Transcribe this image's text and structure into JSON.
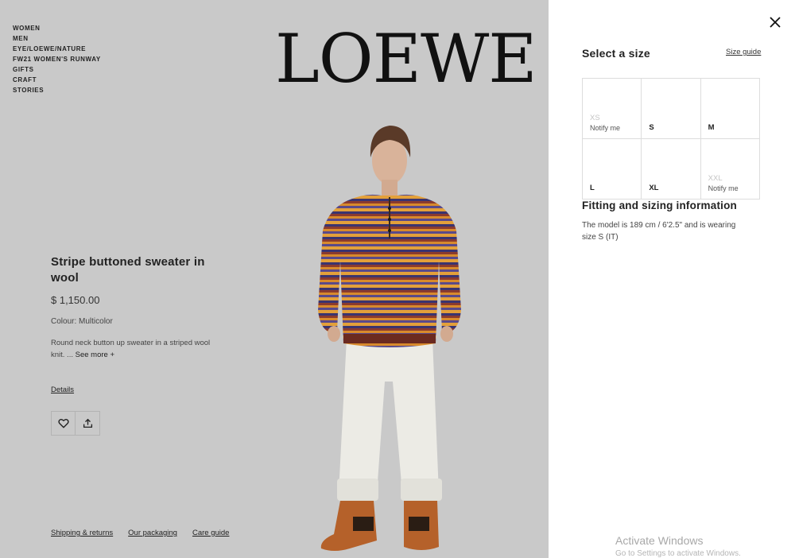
{
  "nav": {
    "items": [
      {
        "label": "WOMEN"
      },
      {
        "label": "MEN"
      },
      {
        "label": "EYE/LOEWE/NATURE"
      },
      {
        "label": "FW21 WOMEN'S RUNWAY"
      },
      {
        "label": "GIFTS"
      },
      {
        "label": "CRAFT"
      },
      {
        "label": "STORIES"
      }
    ]
  },
  "brand": {
    "logo": "LOEWE"
  },
  "product": {
    "title": "Stripe buttoned sweater in wool",
    "price": "$ 1,150.00",
    "colour": "Colour: Multicolor",
    "description": "Round neck button up sweater in a striped wool knit. ...",
    "see_more": "See more +",
    "details_label": "Details",
    "stripe_colors": [
      "#e3a03a",
      "#3a3470",
      "#8b3b2e",
      "#d88a2c",
      "#5a4a8a"
    ]
  },
  "actions": {
    "wishlist_icon": "heart-icon",
    "share_icon": "share-icon"
  },
  "footer": {
    "links": [
      {
        "label": "Shipping & returns"
      },
      {
        "label": "Our packaging"
      },
      {
        "label": "Care guide"
      }
    ]
  },
  "size_panel": {
    "title": "Select a size",
    "size_guide": "Size guide",
    "sizes": [
      {
        "label": "XS",
        "available": false,
        "notify": "Notify me"
      },
      {
        "label": "S",
        "available": true
      },
      {
        "label": "M",
        "available": true
      },
      {
        "label": "L",
        "available": true
      },
      {
        "label": "XL",
        "available": true
      },
      {
        "label": "XXL",
        "available": false,
        "notify": "Notify me"
      }
    ],
    "fitting_title": "Fitting and sizing information",
    "fitting_text": "The model is 189 cm / 6'2.5\" and is wearing size S (IT)"
  },
  "watermark": {
    "line1": "Activate Windows",
    "line2": "Go to Settings to activate Windows."
  },
  "colors": {
    "page_bg": "#c9c9c9",
    "panel_bg": "#ffffff",
    "text": "#1a1a1a"
  }
}
